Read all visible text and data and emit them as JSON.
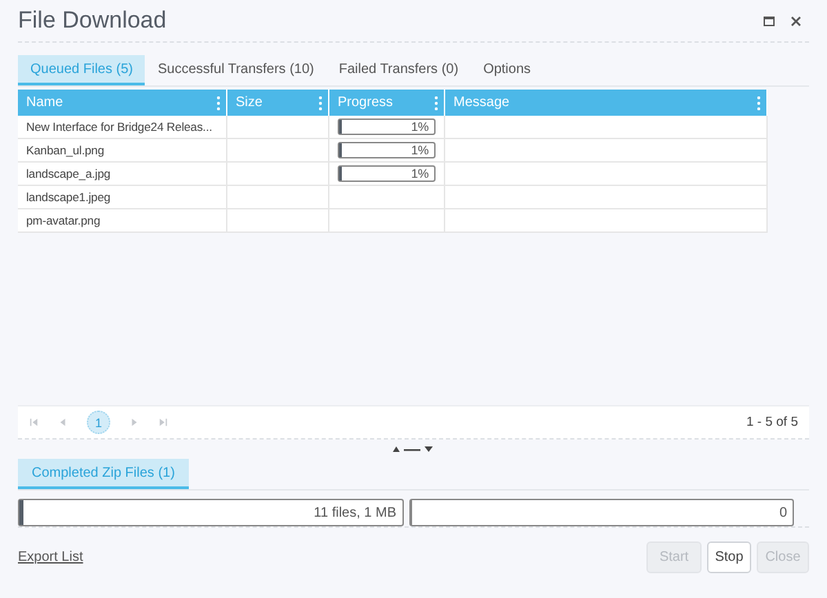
{
  "window": {
    "title": "File Download"
  },
  "tabs": [
    {
      "label": "Queued Files (5)",
      "selected": true
    },
    {
      "label": "Successful Transfers (10)",
      "selected": false
    },
    {
      "label": "Failed Transfers (0)",
      "selected": false
    },
    {
      "label": "Options",
      "selected": false
    }
  ],
  "table": {
    "columns": [
      "Name",
      "Size",
      "Progress",
      "Message"
    ],
    "rows": [
      {
        "name": "New Interface for Bridge24 Releas...",
        "progress": {
          "level": 0.01,
          "reading": "1%"
        }
      },
      {
        "name": "Kanban_ul.png",
        "progress": {
          "level": 0.01,
          "reading": "1%"
        }
      },
      {
        "name": "landscape_a.jpg",
        "progress": {
          "level": 0.01,
          "reading": "1%"
        }
      },
      {
        "name": "landscape1.jpeg"
      },
      {
        "name": "pm-avatar.png"
      }
    ]
  },
  "pager": {
    "pages": [
      {
        "label": "1",
        "selected": true
      }
    ],
    "range": "1 - 5 of 5"
  },
  "zip_tabs": [
    {
      "label": "Completed Zip Files (1)",
      "selected": true
    }
  ],
  "zip_bars": [
    {
      "level": 0.01,
      "reading": "11 files, 1 MB"
    },
    {
      "level": 0,
      "reading": "0"
    }
  ],
  "footer": {
    "link": "Export List",
    "buttons": [
      {
        "label": "Start",
        "disabled": true
      },
      {
        "label": "Stop",
        "disabled": false
      },
      {
        "label": "Close",
        "disabled": true
      }
    ]
  }
}
